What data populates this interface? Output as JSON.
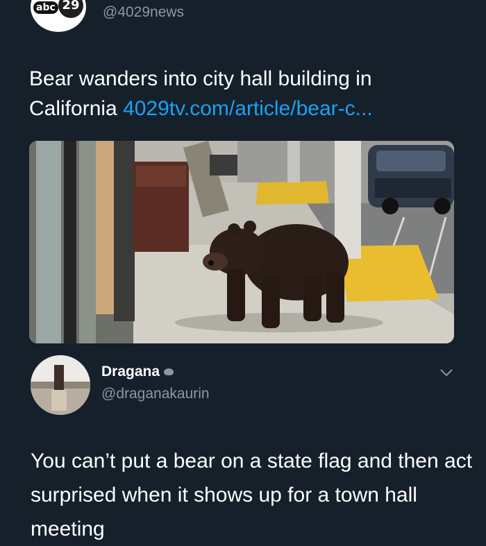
{
  "header": {
    "logo_text": "abc",
    "logo_number": "29",
    "handle": "@4029news"
  },
  "tweet": {
    "text": "Bear wanders into city hall building in California ",
    "link": "4029tv.com/article/bear-c..."
  },
  "media": {
    "icon": "bear-photo"
  },
  "reply": {
    "name": "Dragana",
    "handle": "@draganakaurin",
    "text": "You can’t put a bear on a state flag and then act surprised when it shows up for a town hall meeting"
  },
  "colors": {
    "background": "#15202b",
    "text": "#ffffff",
    "secondary": "#8899a6",
    "link": "#1da1f2"
  }
}
